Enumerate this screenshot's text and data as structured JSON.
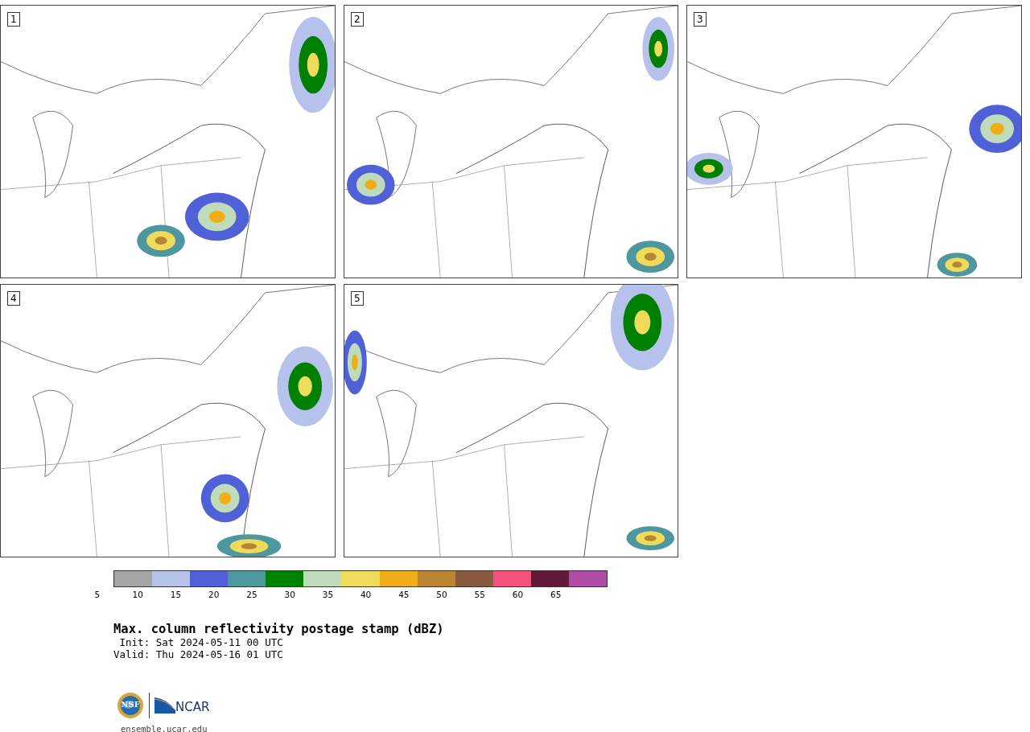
{
  "panels": [
    {
      "label": "1"
    },
    {
      "label": "2"
    },
    {
      "label": "3"
    },
    {
      "label": "4"
    },
    {
      "label": "5"
    }
  ],
  "colorbar": {
    "bins": [
      {
        "color": "#a5a5a5"
      },
      {
        "color": "#b7c2ec"
      },
      {
        "color": "#5060d6"
      },
      {
        "color": "#4e979e"
      },
      {
        "color": "#008000"
      },
      {
        "color": "#bedcbc"
      },
      {
        "color": "#eedb5c"
      },
      {
        "color": "#efae18"
      },
      {
        "color": "#b98530"
      },
      {
        "color": "#8a5a3f"
      },
      {
        "color": "#f4527c"
      },
      {
        "color": "#621a37"
      },
      {
        "color": "#ae4ca8"
      }
    ],
    "ticks": [
      "5",
      "10",
      "15",
      "20",
      "25",
      "30",
      "35",
      "40",
      "45",
      "50",
      "55",
      "60",
      "65"
    ]
  },
  "title": "Max. column reflectivity postage stamp (dBZ)",
  "init": " Init: Sat 2024-05-11 00 UTC",
  "valid": "Valid: Thu 2024-05-16 01 UTC",
  "logos": {
    "left": "NSF",
    "right": "NCAR"
  },
  "url": "ensemble.ucar.edu"
}
